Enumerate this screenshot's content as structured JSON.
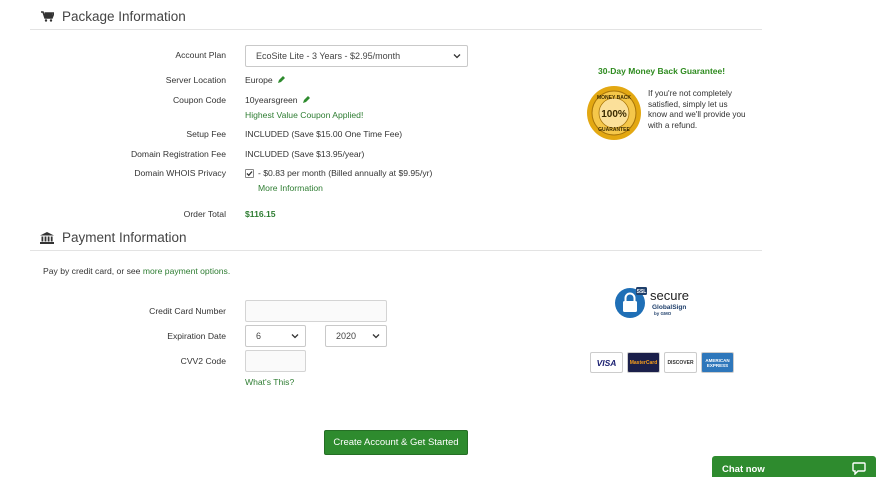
{
  "package": {
    "title": "Package Information",
    "rows": {
      "account_plan_label": "Account Plan",
      "account_plan_value": "EcoSite Lite - 3 Years - $2.95/month",
      "server_location_label": "Server Location",
      "server_location_value": "Europe",
      "coupon_label": "Coupon Code",
      "coupon_value": "10yearsgreen",
      "coupon_note": "Highest Value Coupon Applied!",
      "setup_fee_label": "Setup Fee",
      "setup_fee_value": "INCLUDED (Save $15.00 One Time Fee)",
      "domain_reg_label": "Domain Registration Fee",
      "domain_reg_value": "INCLUDED (Save $13.95/year)",
      "whois_label": "Domain WHOIS Privacy",
      "whois_value": "- $0.83 per month (Billed annually at $9.95/yr)",
      "whois_checked": true,
      "more_info": "More Information",
      "order_total_label": "Order Total",
      "order_total_value": "$116.15"
    },
    "guarantee": {
      "title": "30-Day Money Back Guarantee!",
      "text": "If you're not completely satisfied, simply let us know and we'll provide you with a refund.",
      "seal_lines": [
        "MONEY BACK",
        "100%",
        "GUARANTEE"
      ]
    }
  },
  "payment": {
    "title": "Payment Information",
    "intro_prefix": "Pay by credit card, or see ",
    "intro_link": "more payment options.",
    "card_number_label": "Credit Card Number",
    "card_number_value": "",
    "expiration_label": "Expiration Date",
    "exp_month": "6",
    "exp_year": "2020",
    "cvv_label": "CVV2 Code",
    "cvv_value": "",
    "whats_this": "What's This?",
    "secure_badge": {
      "word": "secure",
      "line1": "GlobalSign",
      "line2": "by GMO",
      "ssl": "SSL"
    },
    "cards": [
      "VISA",
      "MasterCard",
      "DISCOVER",
      "AMERICAN EXPRESS"
    ],
    "submit_label": "Create Account & Get Started"
  },
  "chat": {
    "label": "Chat now"
  },
  "colors": {
    "accent_green": "#2e8b2e",
    "text_green": "#2e7d32",
    "gold": "#e3a812"
  }
}
